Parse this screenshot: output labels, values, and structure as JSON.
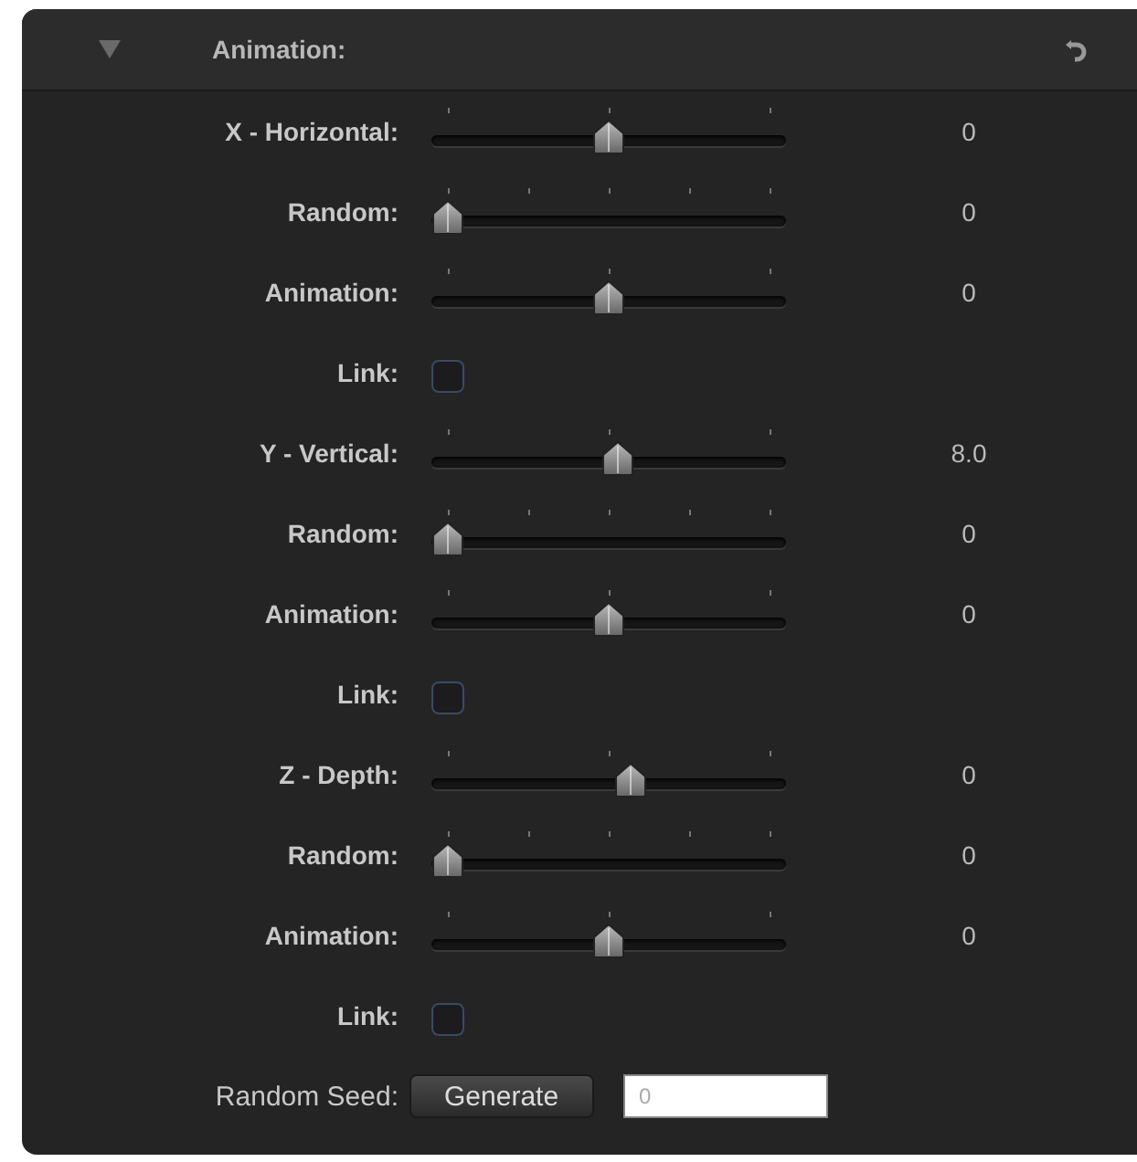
{
  "header": {
    "title": "Animation:",
    "expanded": true
  },
  "rows": [
    {
      "kind": "slider",
      "label": "X - Horizontal:",
      "level": 0.5,
      "value": "0"
    },
    {
      "kind": "stepped-slider",
      "label": "Random:",
      "level": 0,
      "value": "0"
    },
    {
      "kind": "slider",
      "label": "Animation:",
      "level": 0.5,
      "value": "0"
    },
    {
      "kind": "checkbox",
      "label": "Link:",
      "checked": false
    },
    {
      "kind": "slider",
      "label": "Y - Vertical:",
      "level": 0.53,
      "value": "8.0"
    },
    {
      "kind": "stepped-slider",
      "label": "Random:",
      "level": 0,
      "value": "0"
    },
    {
      "kind": "slider",
      "label": "Animation:",
      "level": 0.5,
      "value": "0"
    },
    {
      "kind": "checkbox",
      "label": "Link:",
      "checked": false
    },
    {
      "kind": "slider",
      "label": "Z - Depth:",
      "level": 0.57,
      "value": "0"
    },
    {
      "kind": "stepped-slider",
      "label": "Random:",
      "level": 0,
      "value": "0"
    },
    {
      "kind": "slider",
      "label": "Animation:",
      "level": 0.5,
      "value": "0"
    },
    {
      "kind": "checkbox",
      "label": "Link:",
      "checked": false
    }
  ],
  "seed": {
    "label": "Random Seed:",
    "button": "Generate",
    "placeholder": "0"
  }
}
